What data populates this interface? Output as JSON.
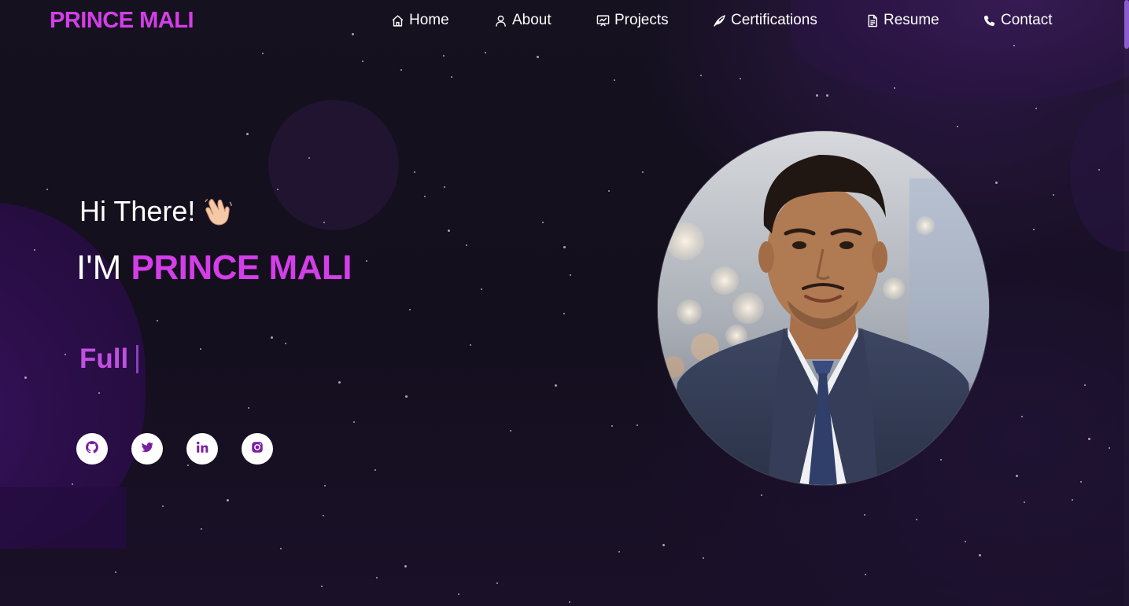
{
  "brand": {
    "logo_text": "PRINCE MALI",
    "accent_color": "#d43ee8"
  },
  "nav": {
    "items": [
      {
        "label": "Home",
        "icon": "home-icon"
      },
      {
        "label": "About",
        "icon": "user-icon"
      },
      {
        "label": "Projects",
        "icon": "presentation-icon"
      },
      {
        "label": "Certifications",
        "icon": "quill-icon"
      },
      {
        "label": "Resume",
        "icon": "document-icon"
      },
      {
        "label": "Contact",
        "icon": "phone-icon"
      }
    ]
  },
  "hero": {
    "greeting": "Hi There!",
    "greeting_emoji": "waving-hand-icon",
    "name_prefix": "I'M",
    "name": "PRINCE MALI",
    "typewriter_text": "Full"
  },
  "socials": [
    {
      "name": "github",
      "icon": "github-icon"
    },
    {
      "name": "twitter",
      "icon": "twitter-icon"
    },
    {
      "name": "linkedin",
      "icon": "linkedin-icon"
    },
    {
      "name": "instagram",
      "icon": "instagram-icon"
    }
  ],
  "colors": {
    "background": "#14101f",
    "accent": "#d43ee8",
    "social_icon": "#7a1fa2"
  }
}
